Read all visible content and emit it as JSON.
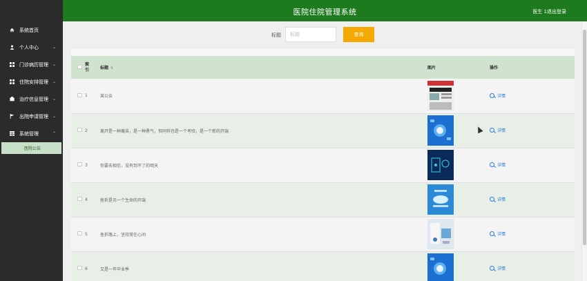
{
  "header": {
    "title": "医院住院管理系统",
    "user": "医生 1",
    "logout": "退出登录",
    "bg_color": "#1e7a1e"
  },
  "sidebar": {
    "items": [
      {
        "label": "系统首页",
        "icon": "home-icon",
        "chevron": ""
      },
      {
        "label": "个人中心",
        "icon": "user-icon",
        "chevron": "⌄"
      },
      {
        "label": "门诊病历管理",
        "icon": "grid-icon",
        "chevron": "⌄"
      },
      {
        "label": "住院安排管理",
        "icon": "grid-icon",
        "chevron": "⌄"
      },
      {
        "label": "治疗信息管理",
        "icon": "box-icon",
        "chevron": "⌄"
      },
      {
        "label": "出院申请管理",
        "icon": "flag-icon",
        "chevron": "⌄"
      },
      {
        "label": "系统管理",
        "icon": "table-icon",
        "chevron": "⌃"
      }
    ],
    "submenu": {
      "label": "医院公告",
      "active": true
    }
  },
  "search": {
    "label": "标题",
    "placeholder": "标题",
    "value": "",
    "button": "查询",
    "button_color": "#f5a800"
  },
  "table": {
    "headers": {
      "index": "索\n引",
      "title": "标题",
      "sort": "⇅",
      "image": "图片",
      "operation": "操作"
    },
    "rows": [
      {
        "index": "1",
        "title": "某公告",
        "action": "详情",
        "image": "newspaper-image"
      },
      {
        "index": "2",
        "title": "离开是一种痛苦，是一种勇气，但同样也是一个考验，是一个新的开端",
        "action": "详情",
        "image": "blue-tech-image"
      },
      {
        "index": "3",
        "title": "你要去相信，没有到不了的明天",
        "action": "详情",
        "image": "dark-tech-image"
      },
      {
        "index": "4",
        "title": "挫折是另一个生命的开端",
        "action": "详情",
        "image": "blue-cloud-image"
      },
      {
        "index": "5",
        "title": "挫折路上，坚持常在心间",
        "action": "详情",
        "image": "medical-image"
      },
      {
        "index": "6",
        "title": "又是一年毕业季",
        "action": "详情",
        "image": "blue-tech-image"
      }
    ]
  }
}
